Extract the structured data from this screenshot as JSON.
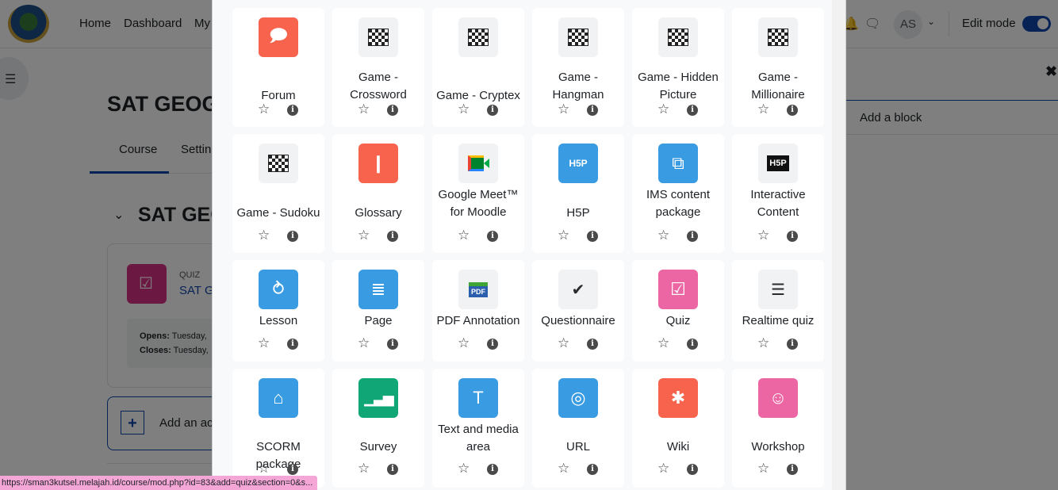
{
  "nav": {
    "items": [
      "Home",
      "Dashboard",
      "My"
    ],
    "avatar_initials": "AS",
    "edit_mode_label": "Edit mode"
  },
  "page": {
    "course_title": "SAT GEOG",
    "tabs": [
      "Course",
      "Settin"
    ],
    "section_title": "SAT GEO",
    "quiz_type": "QUIZ",
    "quiz_name": "SAT GI",
    "opens_label": "Opens:",
    "opens_value": " Tuesday,",
    "closes_label": "Closes:",
    "closes_value": " Tuesday,",
    "add_activity_label": "Add an ac",
    "add_block_label": "Add a block"
  },
  "status_url": "https://sman3kutsel.melajah.id/course/mod.php?id=83&add=quiz&section=0&s...",
  "activities": [
    {
      "name": "Forum",
      "icon": "forum-icon",
      "color": "#f7634d"
    },
    {
      "name": "Game - Crossword",
      "icon": "chessboard-icon",
      "color": "#f1f2f3"
    },
    {
      "name": "Game - Cryptex",
      "icon": "chessboard-icon",
      "color": "#f1f2f3"
    },
    {
      "name": "Game - Hangman",
      "icon": "chessboard-icon",
      "color": "#f1f2f3"
    },
    {
      "name": "Game - Hidden Picture",
      "icon": "chessboard-icon",
      "color": "#f1f2f3"
    },
    {
      "name": "Game - Millionaire",
      "icon": "chessboard-icon",
      "color": "#f1f2f3"
    },
    {
      "name": "Game - Sudoku",
      "icon": "chessboard-icon",
      "color": "#f1f2f3"
    },
    {
      "name": "Glossary",
      "icon": "book-icon",
      "color": "#f7634d"
    },
    {
      "name": "Google Meet™ for Moodle",
      "icon": "google-meet-icon",
      "color": "#f1f2f3"
    },
    {
      "name": "H5P",
      "icon": "h5p-icon",
      "color": "#399be2"
    },
    {
      "name": "IMS content package",
      "icon": "package-icon",
      "color": "#399be2"
    },
    {
      "name": "Interactive Content",
      "icon": "h5p-dark-icon",
      "color": "#f1f2f3"
    },
    {
      "name": "Lesson",
      "icon": "lesson-icon",
      "color": "#399be2"
    },
    {
      "name": "Page",
      "icon": "page-icon",
      "color": "#399be2"
    },
    {
      "name": "PDF Annotation",
      "icon": "pdf-icon",
      "color": "#f1f2f3"
    },
    {
      "name": "Questionnaire",
      "icon": "questionnaire-icon",
      "color": "#f1f2f3"
    },
    {
      "name": "Quiz",
      "icon": "quiz-icon",
      "color": "#eb66a2"
    },
    {
      "name": "Realtime quiz",
      "icon": "list-icon",
      "color": "#f1f2f3"
    },
    {
      "name": "SCORM package",
      "icon": "box-icon",
      "color": "#399be2"
    },
    {
      "name": "Survey",
      "icon": "bar-chart-icon",
      "color": "#11a676"
    },
    {
      "name": "Text and media area",
      "icon": "text-frame-icon",
      "color": "#399be2"
    },
    {
      "name": "URL",
      "icon": "globe-icon",
      "color": "#399be2"
    },
    {
      "name": "Wiki",
      "icon": "network-icon",
      "color": "#f7634d"
    },
    {
      "name": "Workshop",
      "icon": "people-icon",
      "color": "#eb66a2"
    }
  ]
}
